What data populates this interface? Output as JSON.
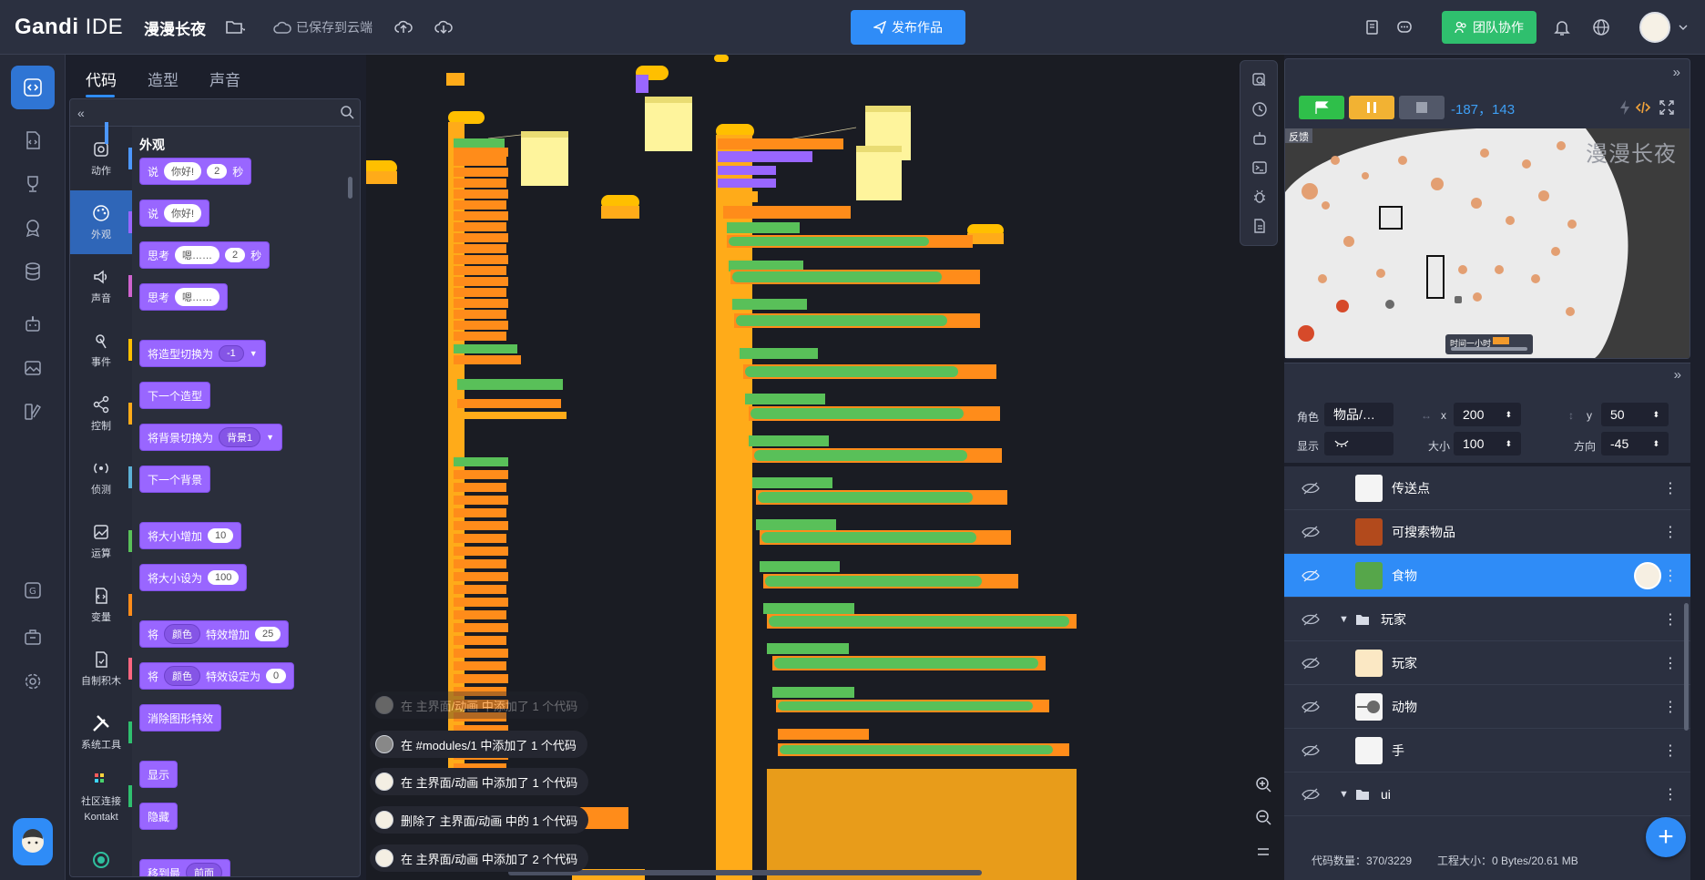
{
  "app": {
    "logo_bold": "Gandi",
    "logo_light": " IDE",
    "project_title": "漫漫长夜",
    "saved_text": "已保存到云端",
    "publish_label": "发布作品",
    "team_label": "团队协作"
  },
  "editor_tabs": [
    "代码",
    "造型",
    "声音"
  ],
  "categories": [
    "动作",
    "外观",
    "声音",
    "事件",
    "控制",
    "侦测",
    "运算",
    "变量",
    "自制积木",
    "系统工具",
    "社区连接"
  ],
  "category_extra": "Kontakt",
  "category_colors": [
    "#4c97ff",
    "#9966ff",
    "#cf63cf",
    "#ffbf00",
    "#ffab19",
    "#5cb1d6",
    "#59c059",
    "#ff8c1a",
    "#ff6680",
    "#2fbf6e",
    "#2fbf6e"
  ],
  "palette": {
    "section_title": "外观",
    "say_timed": {
      "prefix": "说",
      "text": "你好!",
      "secs": "2",
      "suffix": "秒"
    },
    "say": {
      "prefix": "说",
      "text": "你好!"
    },
    "think_timed": {
      "prefix": "思考",
      "text": "嗯……",
      "secs": "2",
      "suffix": "秒"
    },
    "think": {
      "prefix": "思考",
      "text": "嗯……"
    },
    "switch_costume": {
      "label": "将造型切换为",
      "value": "-1"
    },
    "next_costume": "下一个造型",
    "switch_backdrop": {
      "label": "将背景切换为",
      "value": "背景1"
    },
    "next_backdrop": "下一个背景",
    "change_size": {
      "label": "将大小增加",
      "value": "10"
    },
    "set_size": {
      "label": "将大小设为",
      "value": "100"
    },
    "change_effect": {
      "prefix": "将",
      "effect": "颜色",
      "label": "特效增加",
      "value": "25"
    },
    "set_effect": {
      "prefix": "将",
      "effect": "颜色",
      "label": "特效设定为",
      "value": "0"
    },
    "clear_effects": "消除图形特效",
    "show": "显示",
    "hide": "隐藏",
    "goto_layer": {
      "label": "移到最",
      "value": "前面"
    }
  },
  "toasts": [
    {
      "text": "在 主界面/动画 中添加了 1 个代码",
      "faded": true
    },
    {
      "text": "在 #modules/1 中添加了 1 个代码",
      "faded": false
    },
    {
      "text": "在 主界面/动画 中添加了 1 个代码",
      "faded": false
    },
    {
      "text": "删除了 主界面/动画 中的 1 个代码",
      "faded": false
    },
    {
      "text": "在 主界面/动画 中添加了 2 个代码",
      "faded": false
    }
  ],
  "stage": {
    "coords": "-187，143",
    "title": "漫漫长夜",
    "feedback": "反馈",
    "timer_label": "时间一小时"
  },
  "sprite_props": {
    "role_label": "角色",
    "role_value": "物品/…",
    "x_label": "x",
    "x_value": "200",
    "y_label": "y",
    "y_value": "50",
    "show_label": "显示",
    "size_label": "大小",
    "size_value": "100",
    "dir_label": "方向",
    "dir_value": "-45"
  },
  "sprites": [
    {
      "type": "sprite",
      "name": "传送点",
      "selected": false
    },
    {
      "type": "sprite",
      "name": "可搜索物品",
      "selected": false
    },
    {
      "type": "sprite",
      "name": "食物",
      "selected": true
    },
    {
      "type": "folder",
      "name": "玩家",
      "selected": false
    },
    {
      "type": "sprite",
      "name": "玩家",
      "selected": false
    },
    {
      "type": "sprite",
      "name": "动物",
      "selected": false
    },
    {
      "type": "sprite",
      "name": "手",
      "selected": false
    },
    {
      "type": "folder",
      "name": "ui",
      "selected": false
    }
  ],
  "status": {
    "code_count": "代码数量：370/3229",
    "project_size": "工程大小：0 Bytes/20.61 MB"
  },
  "icons": {
    "folder": "folder-icon",
    "cloud": "cloud-icon",
    "upload": "upload-icon",
    "download": "download-icon",
    "bell": "bell-icon",
    "globe": "globe-icon",
    "flag": "green-flag-icon",
    "pause": "pause-icon",
    "stop": "stop-icon",
    "fullscreen": "fullscreen-icon",
    "eye": "eye-icon"
  }
}
